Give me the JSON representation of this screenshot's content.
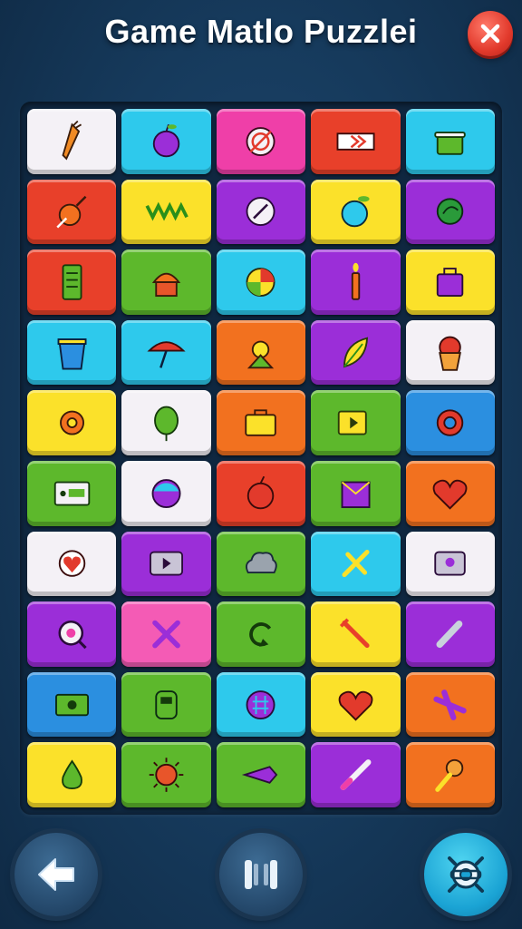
{
  "header": {
    "title": "Game Matlo Puzzlei"
  },
  "colors": {
    "white": "#f4f1f6",
    "cyan": "#2ec9ec",
    "magenta": "#ef3fa8",
    "red": "#e8402a",
    "yellow": "#fbe12a",
    "purple": "#9b2ed8",
    "green": "#5db82c",
    "orange": "#f2711f",
    "blue": "#2b8fe0",
    "pink": "#f45bb5"
  },
  "board": {
    "rows": [
      [
        {
          "color": "white",
          "icon": "carrot-icon"
        },
        {
          "color": "cyan",
          "icon": "plum-icon"
        },
        {
          "color": "magenta",
          "icon": "target-icon"
        },
        {
          "color": "red",
          "icon": "arrow-sign-icon"
        },
        {
          "color": "cyan",
          "icon": "pot-icon"
        }
      ],
      [
        {
          "color": "red",
          "icon": "orange-pen-icon"
        },
        {
          "color": "yellow",
          "icon": "zigzag-icon"
        },
        {
          "color": "purple",
          "icon": "compass-icon"
        },
        {
          "color": "yellow",
          "icon": "blue-fruit-icon"
        },
        {
          "color": "purple",
          "icon": "leaf-ball-icon"
        }
      ],
      [
        {
          "color": "red",
          "icon": "phone-icon"
        },
        {
          "color": "green",
          "icon": "muffin-icon"
        },
        {
          "color": "cyan",
          "icon": "beach-ball-icon"
        },
        {
          "color": "purple",
          "icon": "candle-icon"
        },
        {
          "color": "yellow",
          "icon": "bag-icon"
        }
      ],
      [
        {
          "color": "cyan",
          "icon": "cup-icon"
        },
        {
          "color": "cyan",
          "icon": "umbrella-icon"
        },
        {
          "color": "orange",
          "icon": "creature-icon"
        },
        {
          "color": "purple",
          "icon": "leaf-icon"
        },
        {
          "color": "white",
          "icon": "cupcake-icon"
        }
      ],
      [
        {
          "color": "yellow",
          "icon": "gear-icon"
        },
        {
          "color": "white",
          "icon": "balloon-icon"
        },
        {
          "color": "orange",
          "icon": "suitcase-icon"
        },
        {
          "color": "green",
          "icon": "video-icon"
        },
        {
          "color": "blue",
          "icon": "ring-icon"
        }
      ],
      [
        {
          "color": "green",
          "icon": "device-icon"
        },
        {
          "color": "white",
          "icon": "ball-icon"
        },
        {
          "color": "red",
          "icon": "apple-icon"
        },
        {
          "color": "green",
          "icon": "box-icon"
        },
        {
          "color": "orange",
          "icon": "heart-icon"
        }
      ],
      [
        {
          "color": "white",
          "icon": "flower-icon"
        },
        {
          "color": "purple",
          "icon": "play-icon"
        },
        {
          "color": "green",
          "icon": "cloud-icon"
        },
        {
          "color": "cyan",
          "icon": "cross-icon"
        },
        {
          "color": "white",
          "icon": "lollipop-icon"
        }
      ],
      [
        {
          "color": "purple",
          "icon": "lens-icon"
        },
        {
          "color": "pink",
          "icon": "x-icon"
        },
        {
          "color": "green",
          "icon": "refresh-icon"
        },
        {
          "color": "yellow",
          "icon": "tool-icon"
        },
        {
          "color": "purple",
          "icon": "slash-icon"
        }
      ],
      [
        {
          "color": "blue",
          "icon": "cash-icon"
        },
        {
          "color": "green",
          "icon": "robot-icon"
        },
        {
          "color": "cyan",
          "icon": "grid-icon"
        },
        {
          "color": "yellow",
          "icon": "heart-icon"
        },
        {
          "color": "orange",
          "icon": "plane-icon"
        }
      ],
      [
        {
          "color": "yellow",
          "icon": "pear-icon"
        },
        {
          "color": "green",
          "icon": "sun-icon"
        },
        {
          "color": "green",
          "icon": "wrapper-icon"
        },
        {
          "color": "purple",
          "icon": "knife-icon"
        },
        {
          "color": "orange",
          "icon": "icecream-icon"
        }
      ]
    ]
  },
  "footer": {
    "back": "back-arrow-icon",
    "pause": "pause-bars-icon",
    "settings": "settings-robot-icon"
  }
}
